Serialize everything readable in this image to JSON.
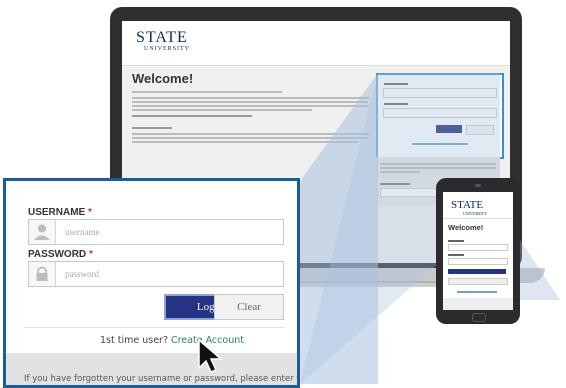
{
  "laptop": {
    "logo": {
      "line1": "STATE",
      "line2": "UNIVERSITY"
    },
    "welcome": "Welcome!",
    "colors": {
      "panel_border": "#3a8fd1",
      "login_button": "#1f2d7a"
    }
  },
  "zoom": {
    "username_label": "USERNAME",
    "username_placeholder": "username",
    "password_label": "PASSWORD",
    "password_placeholder": "password",
    "required_mark": "*",
    "login_label": "Login",
    "clear_label": "Clear",
    "first_time_text": "1st time user?",
    "create_account_label": "Create Account",
    "forgot_text": "If you have forgotten your username or password, please enter your account email address below",
    "icons": {
      "username": "user-icon",
      "password": "lock-icon"
    },
    "colors": {
      "border": "#1b5e97",
      "login_button": "#253384",
      "link": "#2f7d79",
      "required": "#c0392b"
    }
  },
  "phone": {
    "logo": {
      "line1": "STATE",
      "line2": "UNIVERSITY"
    },
    "welcome": "Welcome!"
  }
}
